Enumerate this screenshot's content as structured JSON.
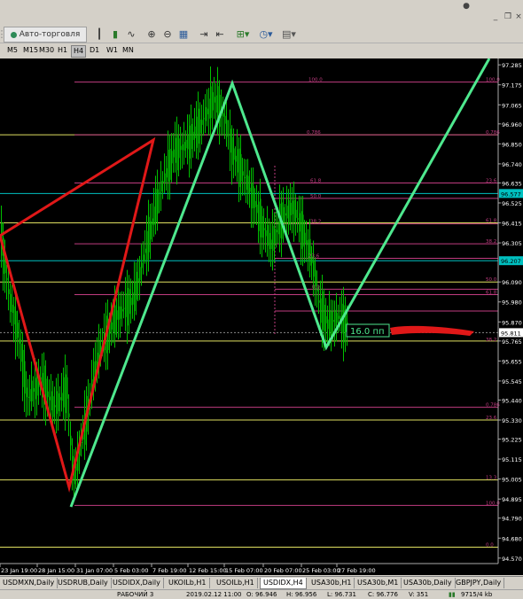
{
  "toolbar": {
    "autotrade_label": "Авто-торговля"
  },
  "timeframes": [
    "M5",
    "M15",
    "M30",
    "H1",
    "H4",
    "D1",
    "W1",
    "MN"
  ],
  "active_timeframe": "H4",
  "price_axis": [
    "97.285",
    "97.175",
    "97.065",
    "96.960",
    "96.850",
    "96.740",
    "96.635",
    "96.525",
    "96.415",
    "96.305",
    "96.090",
    "95.980",
    "95.870",
    "95.765",
    "95.655",
    "95.545",
    "95.440",
    "95.330",
    "95.225",
    "95.115",
    "95.005",
    "94.895",
    "94.790",
    "94.680",
    "94.570"
  ],
  "price_badges": [
    "96.577",
    "96.207",
    "95.811"
  ],
  "time_axis": [
    "23 Jan 19:00",
    "28 Jan 15:00",
    "31 Jan 07:00",
    "5 Feb 03:00",
    "7 Feb 19:00",
    "12 Feb 15:00",
    "15 Feb 07:00",
    "20 Feb 07:00",
    "25 Feb 03:00",
    "27 Feb 19:00"
  ],
  "fib_labels_right": [
    "100.0",
    "0.786",
    "23.6",
    "61.8",
    "38.2",
    "50.0",
    "61.8",
    "38.2",
    "0.786",
    "23.6",
    "13.3",
    "100.0",
    "0.0"
  ],
  "fib_labels_mid": [
    "100.0",
    "0.786",
    "61.8",
    "50.0",
    "38.2",
    "23.6",
    "0.0"
  ],
  "annotation": "16.0 пп",
  "tabs": [
    "USDMXN,Daily",
    "USDRUB,Daily",
    "USDIDX,Daily",
    "UKOILb,H1",
    "USOILb,H1",
    "USDIDX,H4",
    "USA30b,H1",
    "USA30b,M1",
    "USA30b,Daily",
    "GBPJPY,Daily"
  ],
  "active_tab": "USDIDX,H4",
  "status": {
    "profile": "РАБОЧИЙ 3",
    "datetime": "2019.02.12 11:00",
    "open": "O: 96.946",
    "high": "H: 96.956",
    "low": "L: 96.731",
    "close": "C: 96.776",
    "volume": "V: 351",
    "traffic": "9715/4 kb"
  },
  "colors": {
    "background": "#000000",
    "candles": "#00c000",
    "yellow_level": "#e0e060",
    "magenta_fib": "#c03c80",
    "cyan_level": "#00c0c0",
    "red_pattern": "#e01818",
    "green_pattern": "#4ee88e",
    "annotation": "#4ee88e"
  }
}
